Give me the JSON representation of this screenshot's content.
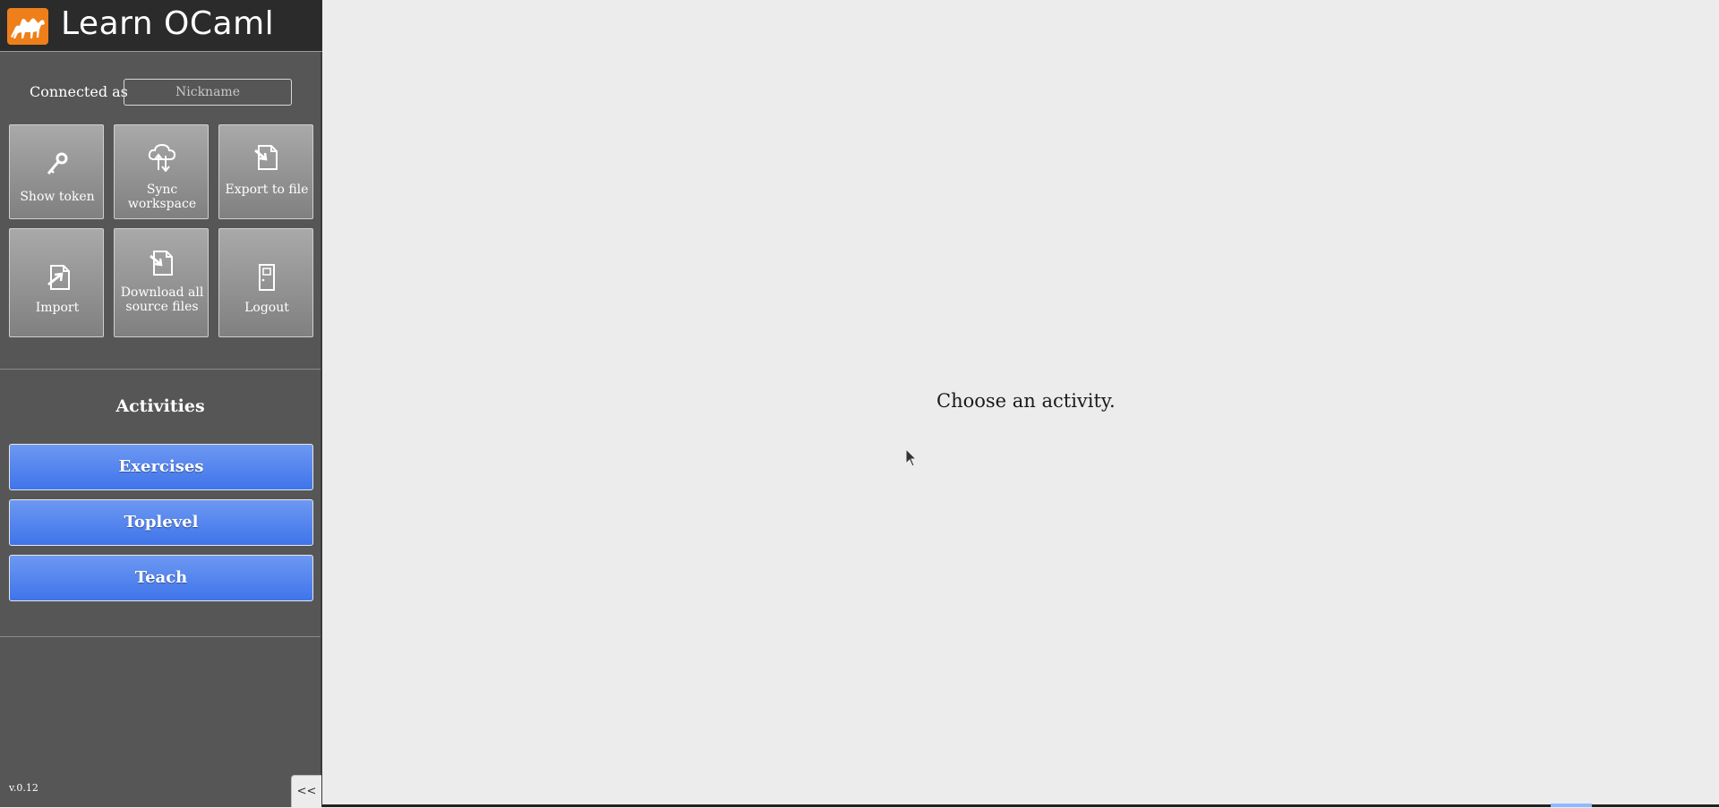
{
  "header": {
    "title": "Learn OCaml",
    "logo_icon": "camel-icon",
    "logo_color": "#ef7f1a"
  },
  "connection": {
    "label": "Connected as",
    "nickname_placeholder": "Nickname",
    "nickname_value": ""
  },
  "toolbar": [
    {
      "label": "Show token",
      "icon": "key-icon"
    },
    {
      "label": "Sync workspace",
      "icon": "cloud-sync-icon"
    },
    {
      "label": "Export to file",
      "icon": "export-file-icon"
    },
    {
      "label": "Import",
      "icon": "import-file-icon"
    },
    {
      "label": "Download all source files",
      "icon": "download-file-icon"
    },
    {
      "label": "Logout",
      "icon": "door-icon"
    }
  ],
  "activities": {
    "title": "Activities",
    "items": [
      {
        "label": "Exercises"
      },
      {
        "label": "Toplevel"
      },
      {
        "label": "Teach"
      }
    ],
    "button_color": "#4a7ff0"
  },
  "footer": {
    "version": "v.0.12",
    "collapse_label": "<<"
  },
  "main": {
    "message": "Choose an activity."
  }
}
